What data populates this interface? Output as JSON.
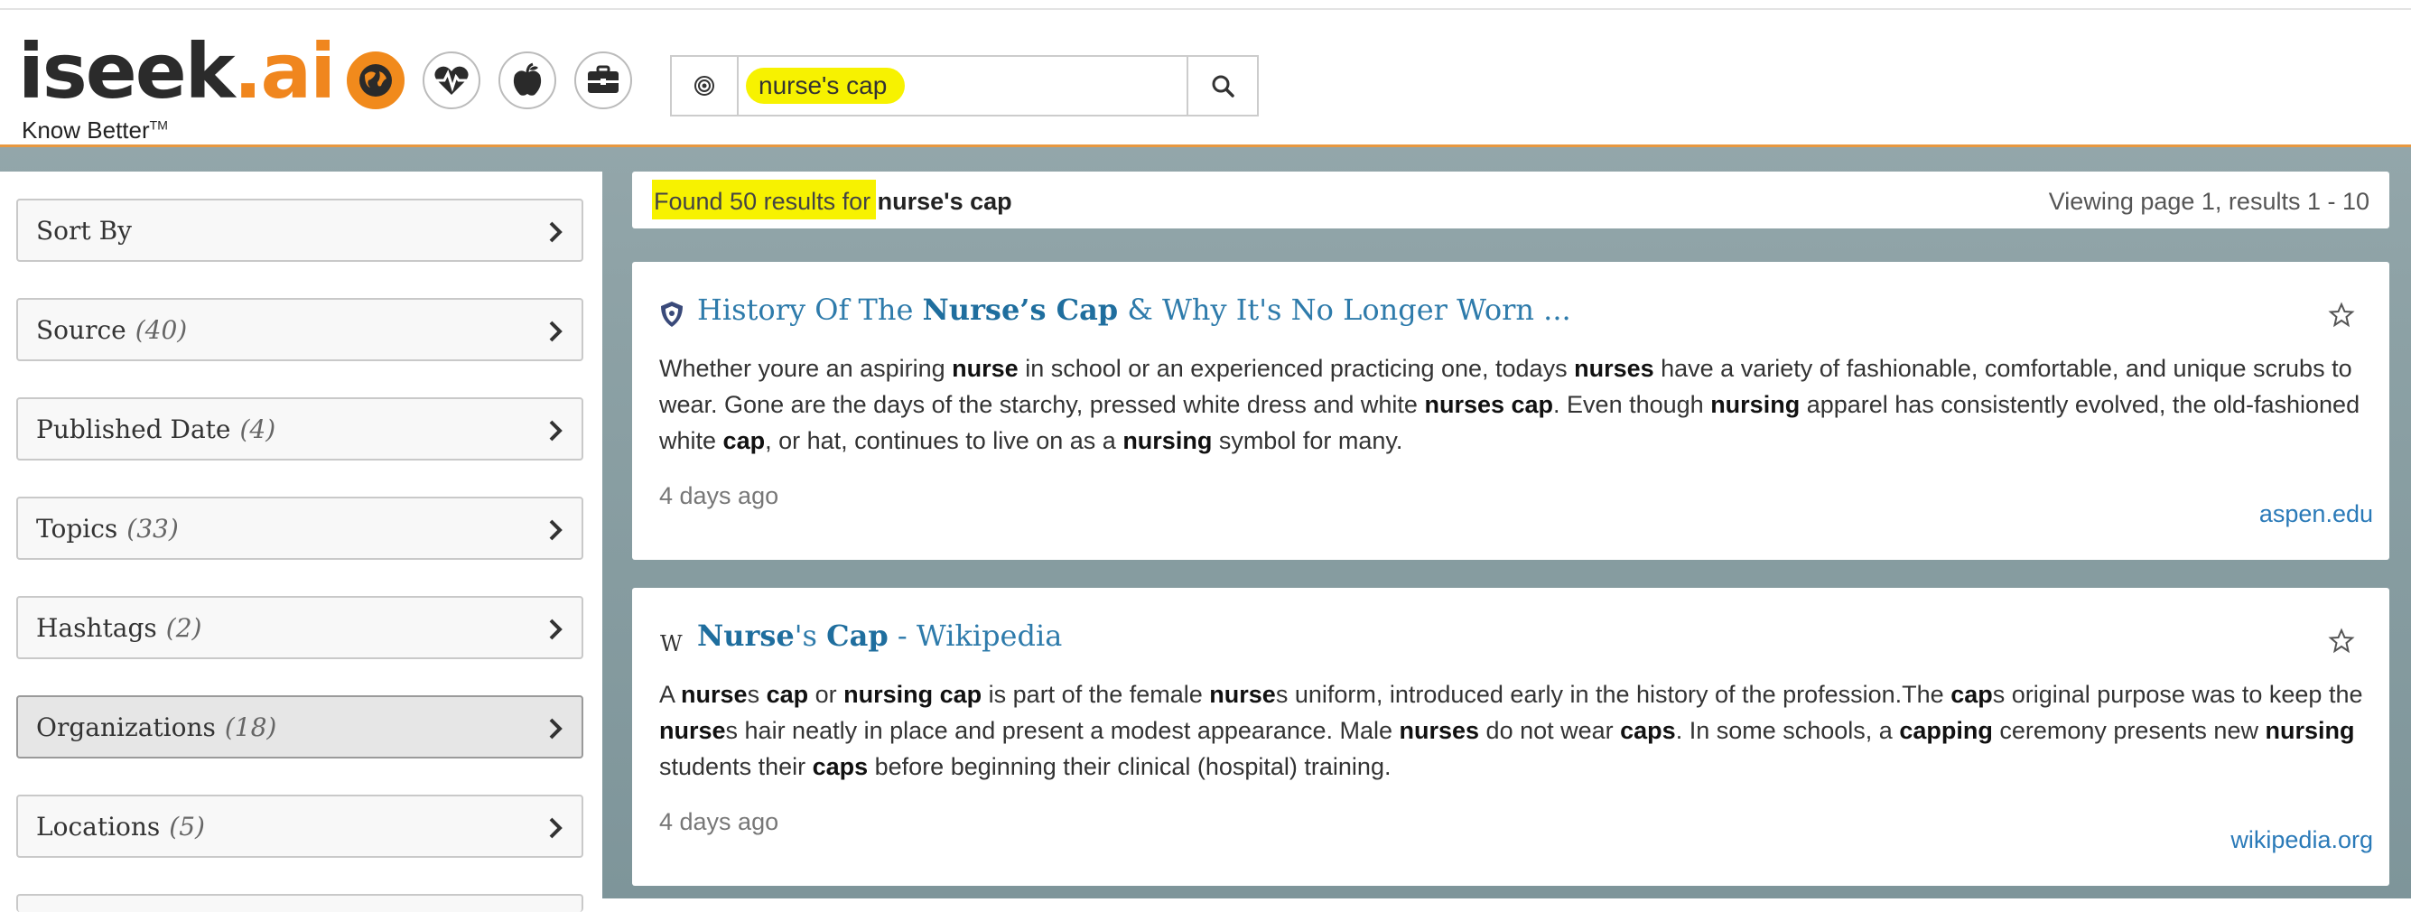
{
  "header": {
    "logo": {
      "brand_main": "iseek",
      "brand_dot": ".",
      "brand_suffix": "ai",
      "tagline": "Know Better",
      "tm": "TM"
    },
    "category_icons": [
      "globe-icon",
      "heartbeat-icon",
      "apple-icon",
      "briefcase-icon"
    ],
    "search": {
      "value": "nurse's cap",
      "placeholder": ""
    }
  },
  "sidebar": {
    "facets": [
      {
        "label": "Sort By",
        "count": ""
      },
      {
        "label": "Source",
        "count": "(40)"
      },
      {
        "label": "Published Date",
        "count": "(4)"
      },
      {
        "label": "Topics",
        "count": "(33)"
      },
      {
        "label": "Hashtags",
        "count": "(2)"
      },
      {
        "label": "Organizations",
        "count": "(18)"
      },
      {
        "label": "Locations",
        "count": "(5)"
      }
    ]
  },
  "results": {
    "found_prefix": "Found 50 results for ",
    "query": "nurse's cap",
    "viewing": "Viewing page 1, results 1 - 10"
  },
  "cards": [
    {
      "title_pre": "History Of The ",
      "title_bold": "Nurse’s Cap",
      "title_post": " & Why It's No Longer Worn ...",
      "snippet": [
        {
          "t": "Whether youre an aspiring ",
          "b": false
        },
        {
          "t": "nurse",
          "b": true
        },
        {
          "t": " in school or an experienced practicing one, todays ",
          "b": false
        },
        {
          "t": "nurses",
          "b": true
        },
        {
          "t": " have a variety of fashionable, comfortable, and unique scrubs to wear. Gone are the days of the starchy, pressed white dress and white ",
          "b": false
        },
        {
          "t": "nurses cap",
          "b": true
        },
        {
          "t": ". Even though ",
          "b": false
        },
        {
          "t": "nursing",
          "b": true
        },
        {
          "t": " apparel has consistently evolved, the old-fashioned white ",
          "b": false
        },
        {
          "t": "cap",
          "b": true
        },
        {
          "t": ", or hat, continues to live on as a ",
          "b": false
        },
        {
          "t": "nursing",
          "b": true
        },
        {
          "t": " symbol for many.",
          "b": false
        }
      ],
      "age": "4 days ago",
      "domain": "aspen.edu",
      "favicon": "shield-icon"
    },
    {
      "title_pre": "",
      "title_bold": "Nurse",
      "title_mid": "'s ",
      "title_bold2": "Cap",
      "title_post": " - Wikipedia",
      "snippet": [
        {
          "t": "A ",
          "b": false
        },
        {
          "t": "nurse",
          "b": true
        },
        {
          "t": "s ",
          "b": false
        },
        {
          "t": "cap",
          "b": true
        },
        {
          "t": " or ",
          "b": false
        },
        {
          "t": "nursing cap",
          "b": true
        },
        {
          "t": " is part of the female ",
          "b": false
        },
        {
          "t": "nurse",
          "b": true
        },
        {
          "t": "s uniform, introduced early in the history of the profession.The ",
          "b": false
        },
        {
          "t": "cap",
          "b": true
        },
        {
          "t": "s original purpose was to keep the ",
          "b": false
        },
        {
          "t": "nurse",
          "b": true
        },
        {
          "t": "s hair neatly in place and present a modest appearance. Male ",
          "b": false
        },
        {
          "t": "nurses",
          "b": true
        },
        {
          "t": " do not wear ",
          "b": false
        },
        {
          "t": "caps",
          "b": true
        },
        {
          "t": ". In some schools, a ",
          "b": false
        },
        {
          "t": "capping",
          "b": true
        },
        {
          "t": " ceremony presents new ",
          "b": false
        },
        {
          "t": "nursing",
          "b": true
        },
        {
          "t": " students their ",
          "b": false
        },
        {
          "t": "caps",
          "b": true
        },
        {
          "t": " before beginning their clinical (hospital) training.",
          "b": false
        }
      ],
      "age": "4 days ago",
      "domain": "wikipedia.org",
      "favicon": "wikipedia-w-icon"
    }
  ],
  "colors": {
    "accent": "#f0861e",
    "link": "#2e7bab",
    "highlight": "#f7f200"
  }
}
